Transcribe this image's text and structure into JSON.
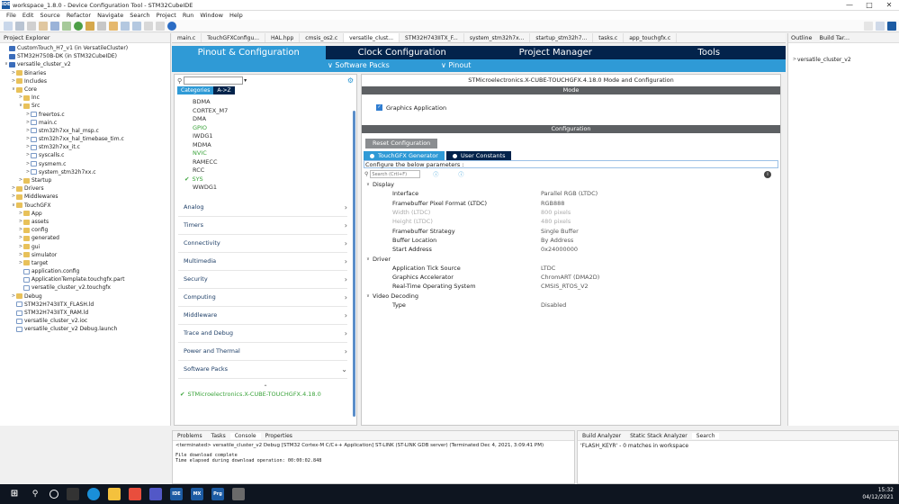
{
  "window": {
    "title": "workspace_1.8.0 - Device Configuration Tool - STM32CubeIDE",
    "logo": "IDE"
  },
  "window_controls": [
    "—",
    "□",
    "✕"
  ],
  "menu": [
    "File",
    "Edit",
    "Source",
    "Refactor",
    "Navigate",
    "Search",
    "Project",
    "Run",
    "Window",
    "Help"
  ],
  "project_explorer": {
    "title": "Project Explorer",
    "items": [
      {
        "label": "CustomTouch_H7_v1 (in VersatileCluster)",
        "level": 0,
        "type": "proj",
        "tw": ""
      },
      {
        "label": "STM32H750B-DK (in STM32CubeIDE)",
        "level": 0,
        "type": "proj",
        "tw": ""
      },
      {
        "label": "versatile_cluster_v2",
        "level": 0,
        "type": "proj",
        "tw": "∨"
      },
      {
        "label": "Binaries",
        "level": 1,
        "type": "fold",
        "tw": ">"
      },
      {
        "label": "Includes",
        "level": 1,
        "type": "fold",
        "tw": ">"
      },
      {
        "label": "Core",
        "level": 1,
        "type": "fold",
        "tw": "∨"
      },
      {
        "label": "Inc",
        "level": 2,
        "type": "fold",
        "tw": ">"
      },
      {
        "label": "Src",
        "level": 2,
        "type": "fold",
        "tw": "∨"
      },
      {
        "label": "freertos.c",
        "level": 3,
        "type": "file",
        "tw": ">"
      },
      {
        "label": "main.c",
        "level": 3,
        "type": "file",
        "tw": ">"
      },
      {
        "label": "stm32h7xx_hal_msp.c",
        "level": 3,
        "type": "file",
        "tw": ">"
      },
      {
        "label": "stm32h7xx_hal_timebase_tim.c",
        "level": 3,
        "type": "file",
        "tw": ">"
      },
      {
        "label": "stm32h7xx_it.c",
        "level": 3,
        "type": "file",
        "tw": ">"
      },
      {
        "label": "syscalls.c",
        "level": 3,
        "type": "file",
        "tw": ">"
      },
      {
        "label": "sysmem.c",
        "level": 3,
        "type": "file",
        "tw": ">"
      },
      {
        "label": "system_stm32h7xx.c",
        "level": 3,
        "type": "file",
        "tw": ">"
      },
      {
        "label": "Startup",
        "level": 2,
        "type": "fold",
        "tw": ">"
      },
      {
        "label": "Drivers",
        "level": 1,
        "type": "fold",
        "tw": ">"
      },
      {
        "label": "Middlewares",
        "level": 1,
        "type": "fold",
        "tw": ">"
      },
      {
        "label": "TouchGFX",
        "level": 1,
        "type": "fold",
        "tw": "∨"
      },
      {
        "label": "App",
        "level": 2,
        "type": "fold",
        "tw": ">"
      },
      {
        "label": "assets",
        "level": 2,
        "type": "fold",
        "tw": ">"
      },
      {
        "label": "config",
        "level": 2,
        "type": "fold",
        "tw": ">"
      },
      {
        "label": "generated",
        "level": 2,
        "type": "fold",
        "tw": ">"
      },
      {
        "label": "gui",
        "level": 2,
        "type": "fold",
        "tw": ">"
      },
      {
        "label": "simulator",
        "level": 2,
        "type": "fold",
        "tw": ">"
      },
      {
        "label": "target",
        "level": 2,
        "type": "fold",
        "tw": ">"
      },
      {
        "label": "application.config",
        "level": 2,
        "type": "file",
        "tw": ""
      },
      {
        "label": "ApplicationTemplate.touchgfx.part",
        "level": 2,
        "type": "file",
        "tw": ""
      },
      {
        "label": "versatile_cluster_v2.touchgfx",
        "level": 2,
        "type": "file",
        "tw": ""
      },
      {
        "label": "Debug",
        "level": 1,
        "type": "fold",
        "tw": ">"
      },
      {
        "label": "STM32H743IITX_FLASH.ld",
        "level": 1,
        "type": "file",
        "tw": ""
      },
      {
        "label": "STM32H743IITX_RAM.ld",
        "level": 1,
        "type": "file",
        "tw": ""
      },
      {
        "label": "versatile_cluster_v2.ioc",
        "level": 1,
        "type": "file",
        "tw": ""
      },
      {
        "label": "versatile_cluster_v2 Debug.launch",
        "level": 1,
        "type": "file",
        "tw": ""
      }
    ]
  },
  "editor_tabs": [
    "main.c",
    "TouchGFXConfigu...",
    "HAL.hpp",
    "cmsis_os2.c",
    "versatile_clust...",
    "STM32H743IITX_F...",
    "system_stm32h7x...",
    "startup_stm32h7...",
    "tasks.c",
    "app_touchgfx.c"
  ],
  "cube_tabs": [
    "Pinout & Configuration",
    "Clock Configuration",
    "Project Manager",
    "Tools"
  ],
  "sub_tabs": [
    "∨ Software Packs",
    "∨ Pinout"
  ],
  "categories": {
    "tab_categories": "Categories",
    "tab_az": "A->Z",
    "peripherals": [
      {
        "label": "BDMA",
        "style": "",
        "check": ""
      },
      {
        "label": "CORTEX_M7",
        "style": "",
        "check": ""
      },
      {
        "label": "DMA",
        "style": "",
        "check": ""
      },
      {
        "label": "GPIO",
        "style": "green",
        "check": ""
      },
      {
        "label": "IWDG1",
        "style": "",
        "check": ""
      },
      {
        "label": "MDMA",
        "style": "",
        "check": ""
      },
      {
        "label": "NVIC",
        "style": "green",
        "check": ""
      },
      {
        "label": "RAMECC",
        "style": "",
        "check": ""
      },
      {
        "label": "RCC",
        "style": "",
        "check": ""
      },
      {
        "label": "SYS",
        "style": "green",
        "check": "✔"
      },
      {
        "label": "WWDG1",
        "style": "",
        "check": ""
      }
    ],
    "groups": [
      "Analog",
      "Timers",
      "Connectivity",
      "Multimedia",
      "Security",
      "Computing",
      "Middleware",
      "Trace and Debug",
      "Power and Thermal",
      "Software Packs"
    ],
    "pack_item": "STMicroelectronics.X-CUBE-TOUCHGFX.4.18.0",
    "pack_check": "✔"
  },
  "config": {
    "title": "STMicroelectronics.X-CUBE-TOUCHGFX.4.18.0 Mode and Configuration",
    "mode_header": "Mode",
    "graphics_app": "Graphics Application",
    "config_header": "Configuration",
    "reset_btn": "Reset Configuration",
    "tab_generator": "TouchGFX Generator",
    "tab_user": "User Constants",
    "configure_text": "Configure the below parameters :",
    "search_placeholder": "Search (Crtl+F)",
    "groups": [
      {
        "name": "Display",
        "params": [
          {
            "k": "Interface",
            "v": "Parallel RGB (LTDC)",
            "dis": false
          },
          {
            "k": "Framebuffer Pixel Format (LTDC)",
            "v": "RGB888",
            "dis": false
          },
          {
            "k": "Width (LTDC)",
            "v": "800 pixels",
            "dis": true
          },
          {
            "k": "Height (LTDC)",
            "v": "480 pixels",
            "dis": true
          },
          {
            "k": "Framebuffer Strategy",
            "v": "Single Buffer",
            "dis": false
          },
          {
            "k": "Buffer Location",
            "v": "By Address",
            "dis": false
          },
          {
            "k": "Start Address",
            "v": "0x24000000",
            "dis": false
          }
        ]
      },
      {
        "name": "Driver",
        "params": [
          {
            "k": "Application Tick Source",
            "v": "LTDC",
            "dis": false
          },
          {
            "k": "Graphics Accelerator",
            "v": "ChromART (DMA2D)",
            "dis": false
          },
          {
            "k": "Real-Time Operating System",
            "v": "CMSIS_RTOS_V2",
            "dis": false
          }
        ]
      },
      {
        "name": "Video Decoding",
        "params": [
          {
            "k": "Type",
            "v": "Disabled",
            "dis": false
          }
        ]
      }
    ]
  },
  "outline": {
    "tab1": "Outline",
    "tab2": "Build Tar...",
    "item": "versatile_cluster_v2"
  },
  "console": {
    "tabs": [
      "Problems",
      "Tasks",
      "Console",
      "Properties"
    ],
    "status": "<terminated> versatile_cluster_v2 Debug [STM32 Cortex-M C/C++ Application] ST-LINK (ST-LINK GDB server) (Terminated Dec 4, 2021, 3:09:41 PM)",
    "lines": [
      "File download complete",
      "Time elapsed during download operation: 00:00:02.848"
    ]
  },
  "bottom_right": {
    "tabs": [
      "Build Analyzer",
      "Static Stack Analyzer",
      "Search"
    ],
    "result": "'FLASH_KEYR' - 0 matches in workspace"
  },
  "taskbar": {
    "time": "15:32",
    "date": "04/12/2021",
    "apps": [
      "IDE",
      "MX",
      "Prg"
    ]
  },
  "colors": {
    "cube_dark": "#03234b",
    "cube_blue": "#2f9ad6",
    "ok_green": "#3aa33a"
  }
}
